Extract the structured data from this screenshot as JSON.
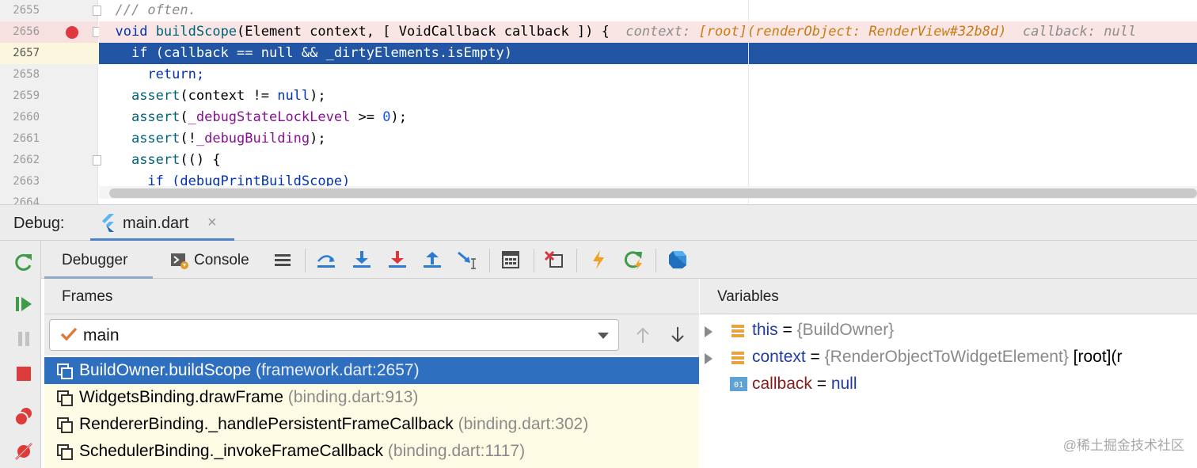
{
  "editor": {
    "line_numbers": [
      "2655",
      "2656",
      "2657",
      "2658",
      "2659",
      "2660",
      "2661",
      "2662",
      "2663",
      "2664"
    ],
    "lines": {
      "l2655": "/// often.",
      "l2656_kw": "void",
      "l2656_fn": "buildScope",
      "l2656_rest": "(Element context, [ VoidCallback callback ]) {",
      "l2656_hint1": "context: ",
      "l2656_hint2": "[root](renderObject: RenderView#32b8d)",
      "l2656_hint3": "callback: null",
      "l2657": "if (callback == null && _dirtyElements.isEmpty)",
      "l2658": "return;",
      "l2659_fn": "assert",
      "l2659_rest": "(context != ",
      "l2659_kw": "null",
      "l2659_end": ");",
      "l2660_fn": "assert",
      "l2660_fld": "_debugStateLockLevel",
      "l2660_mid": " >= ",
      "l2660_num": "0",
      "l2660_end": ");",
      "l2661_fn": "assert",
      "l2661_pre": "(!",
      "l2661_fld": "_debugBuilding",
      "l2661_end": ");",
      "l2662_fn": "assert",
      "l2662_rest": "(() {",
      "l2663": "if (debugPrintBuildScope)"
    }
  },
  "debug_window": {
    "label": "Debug:",
    "run_tab": "main.dart",
    "tabs": {
      "debugger": "Debugger",
      "console": "Console"
    }
  },
  "frames": {
    "header": "Frames",
    "thread": "main",
    "items": [
      {
        "name": "BuildOwner.buildScope",
        "loc": "(framework.dart:2657)"
      },
      {
        "name": "WidgetsBinding.drawFrame",
        "loc": "(binding.dart:913)"
      },
      {
        "name": "RendererBinding._handlePersistentFrameCallback",
        "loc": "(binding.dart:302)"
      },
      {
        "name": "SchedulerBinding._invokeFrameCallback",
        "loc": "(binding.dart:1117)"
      }
    ]
  },
  "variables": {
    "header": "Variables",
    "items": [
      {
        "name": "this",
        "eq": " = ",
        "type": "{BuildOwner}",
        "extra": ""
      },
      {
        "name": "context",
        "eq": " = ",
        "type": "{RenderObjectToWidgetElement}",
        "extra": " [root](r"
      },
      {
        "name": "callback",
        "eq": " = ",
        "value": "null"
      }
    ]
  },
  "watermark": "@稀土掘金技术社区",
  "colors": {
    "execution_line": "#2255a3",
    "breakpoint": "#e0383e",
    "selected_frame": "#2f6fc0",
    "frames_bg": "#fefbe5"
  }
}
